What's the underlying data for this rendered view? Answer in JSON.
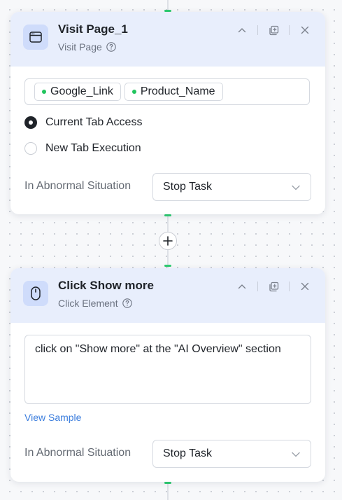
{
  "nodes": [
    {
      "title": "Visit Page_1",
      "subtitle": "Visit Page",
      "icon": "browser-window-icon",
      "variables": [
        "Google_Link",
        "Product_Name"
      ],
      "tab_options": [
        {
          "label": "Current Tab Access",
          "selected": true
        },
        {
          "label": "New Tab Execution",
          "selected": false
        }
      ],
      "abnormal_label": "In Abnormal Situation",
      "abnormal_value": "Stop Task"
    },
    {
      "title": "Click Show more",
      "subtitle": "Click Element",
      "icon": "mouse-icon",
      "prompt": "click on \"Show more\" at the \"AI Overview\" section",
      "sample_link": "View Sample",
      "abnormal_label": "In Abnormal Situation",
      "abnormal_value": "Stop Task"
    }
  ],
  "colors": {
    "canvas": "#f7f8fa",
    "header": "#e8eefc",
    "icon_bg": "#cfdcfb",
    "status_green": "#22c55e",
    "link": "#3b7ddd"
  }
}
